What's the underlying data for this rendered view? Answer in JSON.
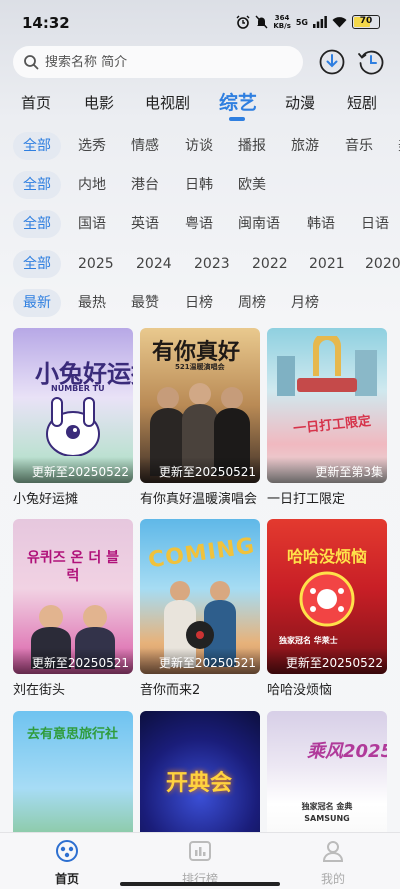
{
  "status": {
    "time": "14:32",
    "net_speed_value": "364",
    "net_speed_unit": "KB/s",
    "signal": "5G",
    "battery": "70"
  },
  "search": {
    "placeholder": "搜索名称 简介"
  },
  "categories": [
    {
      "label": "首页"
    },
    {
      "label": "电影"
    },
    {
      "label": "电视剧"
    },
    {
      "label": "综艺",
      "active": true
    },
    {
      "label": "动漫"
    },
    {
      "label": "短剧"
    }
  ],
  "filters": {
    "type": [
      "全部",
      "选秀",
      "情感",
      "访谈",
      "播报",
      "旅游",
      "音乐",
      "美"
    ],
    "region": [
      "全部",
      "内地",
      "港台",
      "日韩",
      "欧美"
    ],
    "language": [
      "全部",
      "国语",
      "英语",
      "粤语",
      "闽南语",
      "韩语",
      "日语"
    ],
    "year": [
      "全部",
      "2025",
      "2024",
      "2023",
      "2022",
      "2021",
      "2020"
    ],
    "sort": [
      "最新",
      "最热",
      "最赞",
      "日榜",
      "周榜",
      "月榜"
    ]
  },
  "cards": [
    {
      "title": "小兔好运摊",
      "badge": "更新至20250522",
      "poster_text": "小兔好运摊",
      "poster_sub": "NUMBER TU"
    },
    {
      "title": "有你真好温暖演唱会",
      "badge": "更新至20250521",
      "poster_text": "有你真好",
      "poster_sub": "521温暖演唱会"
    },
    {
      "title": "一日打工限定",
      "badge": "更新至第3集",
      "poster_text": "一日打工限定",
      "poster_sub": ""
    },
    {
      "title": "刘在街头",
      "badge": "更新至20250521",
      "poster_text": "유퀴즈 온 더 블럭",
      "poster_sub": ""
    },
    {
      "title": "音你而来2",
      "badge": "更新至20250521",
      "poster_text": "COMING",
      "poster_sub": ""
    },
    {
      "title": "哈哈没烦恼",
      "badge": "更新至20250522",
      "poster_text": "哈哈没烦恼",
      "poster_sub": "独家冠名 华莱士"
    },
    {
      "title": "",
      "badge": "",
      "poster_text": "去有意思旅行社",
      "poster_sub": ""
    },
    {
      "title": "",
      "badge": "",
      "poster_text": "开典会",
      "poster_sub": ""
    },
    {
      "title": "",
      "badge": "",
      "poster_text": "乘风2025",
      "poster_sub": "独家冠名 金典 SAMSUNG"
    }
  ],
  "bottom_nav": [
    {
      "label": "首页",
      "active": true
    },
    {
      "label": "排行榜"
    },
    {
      "label": "我的"
    }
  ],
  "colors": {
    "accent": "#2f7fe0",
    "chip_bg": "#e4e9f1"
  }
}
